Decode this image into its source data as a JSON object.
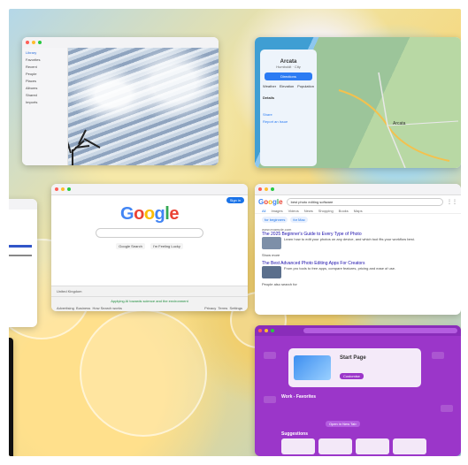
{
  "photos": {
    "sidebar": [
      "Library",
      "Favorites",
      "Recent",
      "People",
      "Places",
      "Albums",
      "Shared",
      "Imports"
    ]
  },
  "maps": {
    "place_name": "Arcata",
    "subtitle": "Humboldt · City",
    "directions_label": "Directions",
    "stats_labels": [
      "Weather",
      "Elevation",
      "Population"
    ],
    "details_title": "Details",
    "city_label": "Arcata",
    "action_labels": [
      "Share",
      "Report an Issue"
    ]
  },
  "google": {
    "logo": "Google",
    "search_value": "",
    "buttons": [
      "Google Search",
      "I'm Feeling Lucky"
    ],
    "footer_country": "United Kingdom",
    "footer_left": [
      "Advertising",
      "Business",
      "How Search works"
    ],
    "footer_right": [
      "Privacy",
      "Terms",
      "Settings"
    ],
    "signin": "Sign in",
    "footer_notice": "Applying AI towards science and the environment"
  },
  "results": {
    "query": "best photo editing software",
    "tabs": [
      "All",
      "Images",
      "Videos",
      "News",
      "Shopping",
      "Books",
      "Maps"
    ],
    "chips": [
      "for beginners",
      "for Mac"
    ],
    "items": [
      {
        "title": "The 2025 Beginner's Guide to Every Type of Photo",
        "source": "www.example.com",
        "snippet": "Learn how to edit your photos on any device, and which tool fits your workflow best."
      },
      {
        "title": "The Best Advanced Photo Editing Apps For Creators",
        "source": "www.example.org",
        "snippet": "From pro tools to free apps, compare features, pricing and ease of use."
      }
    ],
    "more": "Show more",
    "related": "People also search for"
  },
  "purple": {
    "card_title": "Start Page",
    "card_button": "Customise",
    "section": "Work - Favorites",
    "suggestions": "Suggestions",
    "cta": "Open in New Tab"
  }
}
